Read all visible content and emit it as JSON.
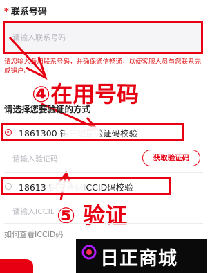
{
  "contact": {
    "required_mark": "*",
    "title": "联系号码",
    "placeholder": "请输入联系号码",
    "tip": "请您输入备用联系号码，并确保通信畅通，以便客服人员与您联系完成销户。"
  },
  "steps": {
    "step4": "④在用号码",
    "step5": "⑤ 验证"
  },
  "verify": {
    "title": "请选择您要验证的方式",
    "options": [
      {
        "label": "1861300 销户短信验证码校验",
        "checked": true
      },
      {
        "label": "18613 销户号码ICCID码校验",
        "checked": false
      }
    ],
    "code_placeholder": "请输入验证码",
    "get_code_label": "获取验证码",
    "iccid_placeholder": "请输入ICCID码",
    "howto_label": "如何查看ICCID码"
  },
  "branding": {
    "logo_text": "日正商城"
  },
  "colors": {
    "accent": "#e60012",
    "input_bg": "#f5f5f7"
  }
}
